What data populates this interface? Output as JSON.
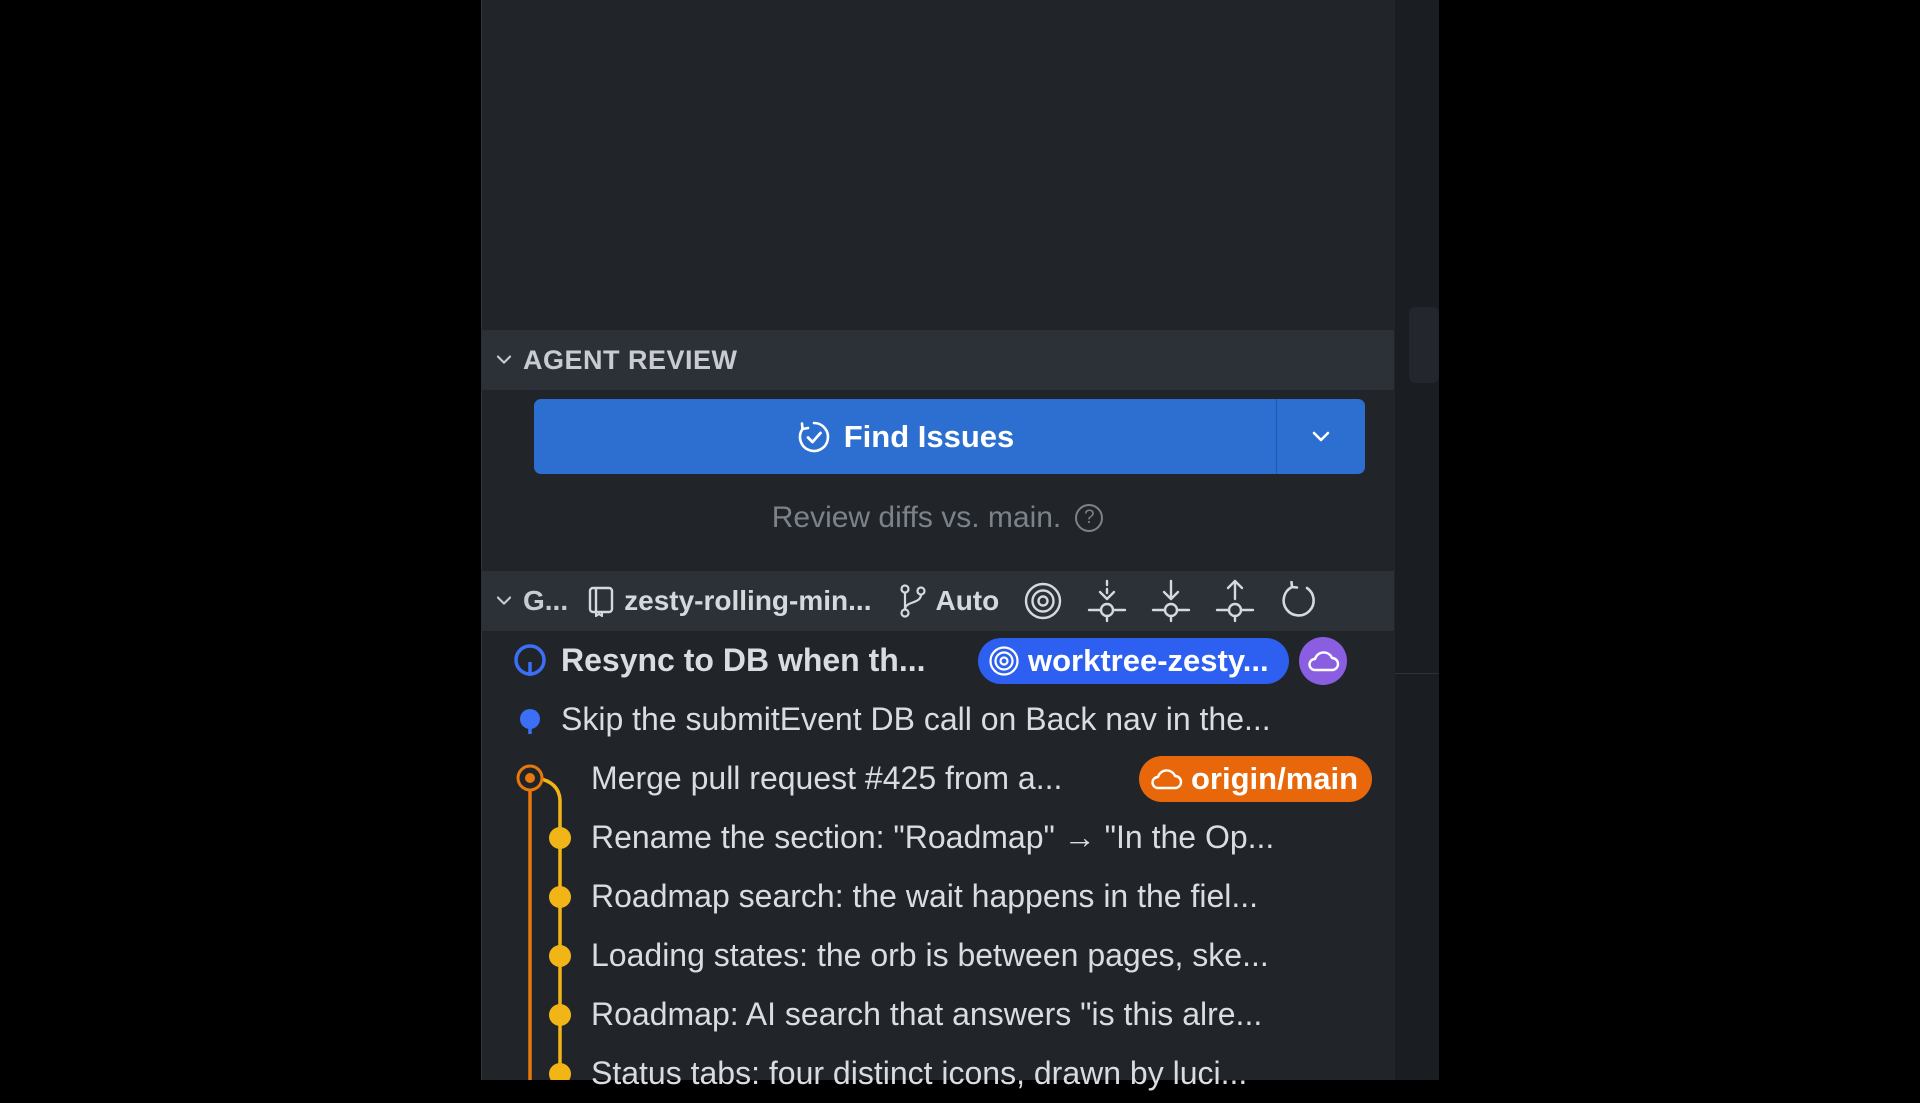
{
  "colors": {
    "background": "#000000",
    "panel": "#212529",
    "section_header": "#2c3138",
    "accent_blue": "#2d6fd0",
    "branch_blue": "#2d5ff0",
    "branch_orange": "#e8670a",
    "lane_blue": "#3b6ff5",
    "lane_orange": "#e6780e",
    "lane_yellow": "#f2b518",
    "cloud_purple": "#8a5ee0"
  },
  "agent_review": {
    "title": "AGENT REVIEW",
    "find_button_label": "Find Issues",
    "hint": "Review diffs vs. main.",
    "icons": [
      "chevron-down-icon",
      "find-issues-icon",
      "dropdown-chevron-icon",
      "help-icon"
    ]
  },
  "git": {
    "title": "G...",
    "worktree": "zesty-rolling-min...",
    "branch_mode": "Auto",
    "toolbar_icons": [
      "target-icon",
      "fetch-icon",
      "pull-icon",
      "push-icon",
      "refresh-icon"
    ]
  },
  "commits": [
    {
      "message": "Resync to DB when th...",
      "badge": "worktree-zesty...",
      "badge_icon": "target-icon",
      "cloud": true,
      "lane": "blue",
      "node": "hollow",
      "bold": true
    },
    {
      "message": "Skip the submitEvent DB call on Back nav in the...",
      "lane": "blue",
      "node": "dot"
    },
    {
      "message": "Merge pull request #425 from a...",
      "badge": "origin/main",
      "badge_icon": "cloud-icon",
      "lane": "orange",
      "node": "merge"
    },
    {
      "message": "Rename the section: \"Roadmap\" → \"In the Op...",
      "lane": "yellow",
      "node": "dot"
    },
    {
      "message": "Roadmap search: the wait happens in the fiel...",
      "lane": "yellow",
      "node": "dot"
    },
    {
      "message": "Loading states: the orb is between pages, ske...",
      "lane": "yellow",
      "node": "dot"
    },
    {
      "message": "Roadmap: AI search that answers \"is this alre...",
      "lane": "yellow",
      "node": "dot"
    },
    {
      "message": "Status tabs: four distinct icons, drawn by luci...",
      "lane": "yellow",
      "node": "dot"
    }
  ]
}
